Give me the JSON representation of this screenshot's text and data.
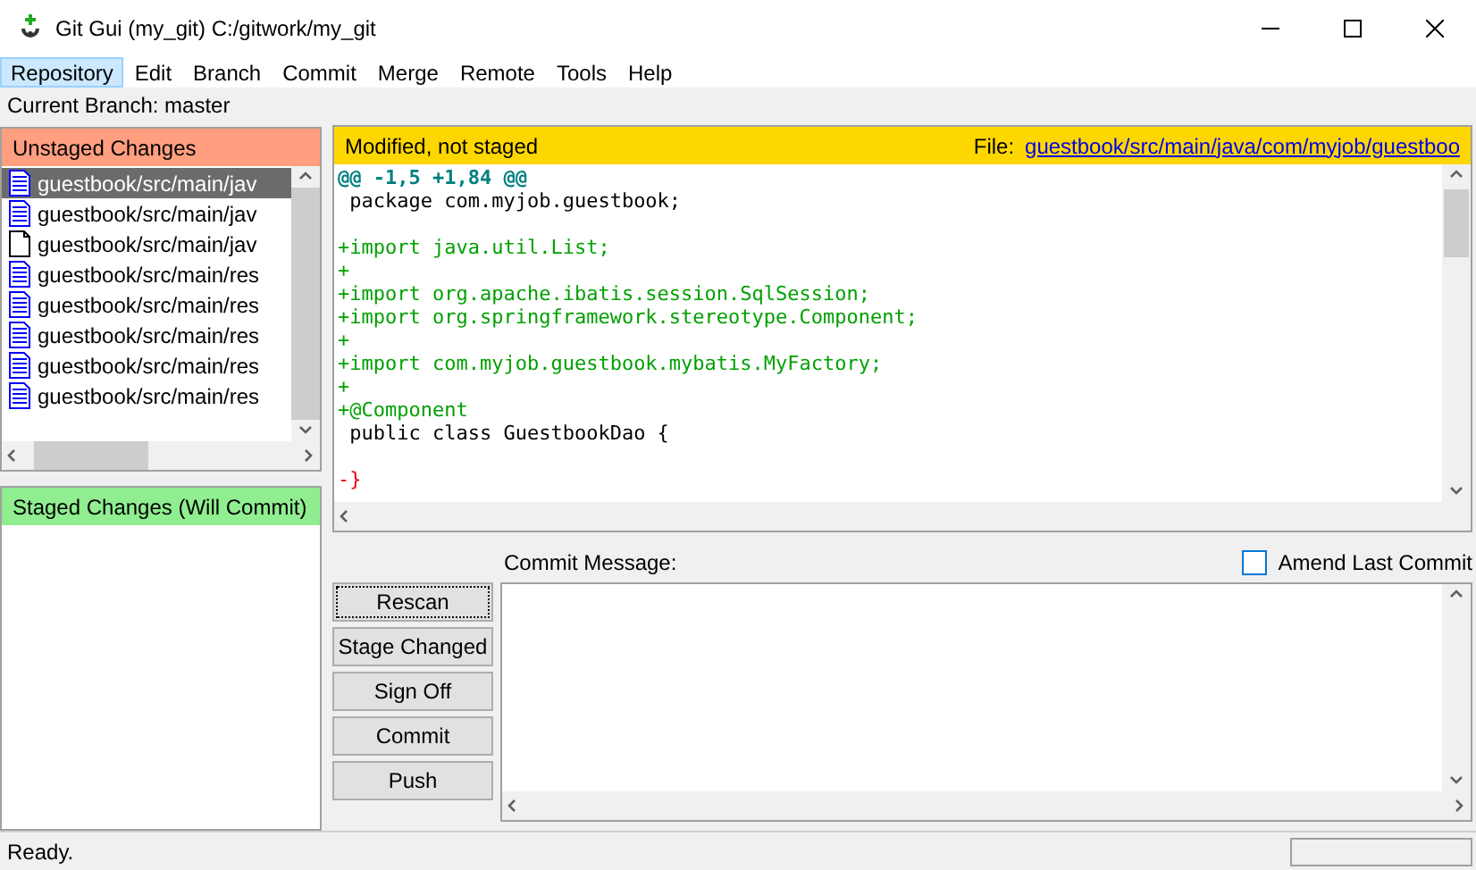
{
  "window": {
    "title": "Git Gui (my_git) C:/gitwork/my_git"
  },
  "menu": [
    {
      "label": "Repository",
      "selected": true
    },
    {
      "label": "Edit",
      "selected": false
    },
    {
      "label": "Branch",
      "selected": false
    },
    {
      "label": "Commit",
      "selected": false
    },
    {
      "label": "Merge",
      "selected": false
    },
    {
      "label": "Remote",
      "selected": false
    },
    {
      "label": "Tools",
      "selected": false
    },
    {
      "label": "Help",
      "selected": false
    }
  ],
  "current_branch": "Current Branch: master",
  "unstaged": {
    "title": "Unstaged Changes",
    "files": [
      {
        "name": "guestbook/src/main/jav",
        "kind": "modified",
        "selected": true
      },
      {
        "name": "guestbook/src/main/jav",
        "kind": "modified",
        "selected": false
      },
      {
        "name": "guestbook/src/main/jav",
        "kind": "new",
        "selected": false
      },
      {
        "name": "guestbook/src/main/res",
        "kind": "modified",
        "selected": false
      },
      {
        "name": "guestbook/src/main/res",
        "kind": "modified",
        "selected": false
      },
      {
        "name": "guestbook/src/main/res",
        "kind": "modified",
        "selected": false
      },
      {
        "name": "guestbook/src/main/res",
        "kind": "modified",
        "selected": false
      },
      {
        "name": "guestbook/src/main/res",
        "kind": "modified",
        "selected": false
      }
    ]
  },
  "staged": {
    "title": "Staged Changes (Will Commit)"
  },
  "diff": {
    "status": "Modified, not staged",
    "file_label": "File:",
    "file_path": "guestbook/src/main/java/com/myjob/guestboo",
    "lines": [
      {
        "kind": "hunk",
        "text": "@@ -1,5 +1,84 @@"
      },
      {
        "kind": "context",
        "text": " package com.myjob.guestbook;"
      },
      {
        "kind": "blank"
      },
      {
        "kind": "add",
        "text": "+import java.util.List;"
      },
      {
        "kind": "add",
        "text": "+"
      },
      {
        "kind": "add",
        "text": "+import org.apache.ibatis.session.SqlSession;"
      },
      {
        "kind": "add",
        "text": "+import org.springframework.stereotype.Component;"
      },
      {
        "kind": "add",
        "text": "+"
      },
      {
        "kind": "add",
        "text": "+import com.myjob.guestbook.mybatis.MyFactory;"
      },
      {
        "kind": "add",
        "text": "+"
      },
      {
        "kind": "add",
        "text": "+@Component"
      },
      {
        "kind": "context",
        "text": " public class GuestbookDao {"
      },
      {
        "kind": "blank"
      },
      {
        "kind": "remove",
        "text": "-}"
      }
    ]
  },
  "buttons": [
    "Rescan",
    "Stage Changed",
    "Sign Off",
    "Commit",
    "Push"
  ],
  "commit": {
    "label": "Commit Message:",
    "amend": {
      "label": "Amend Last Commit",
      "checked": false
    }
  },
  "status_bar": "Ready."
}
